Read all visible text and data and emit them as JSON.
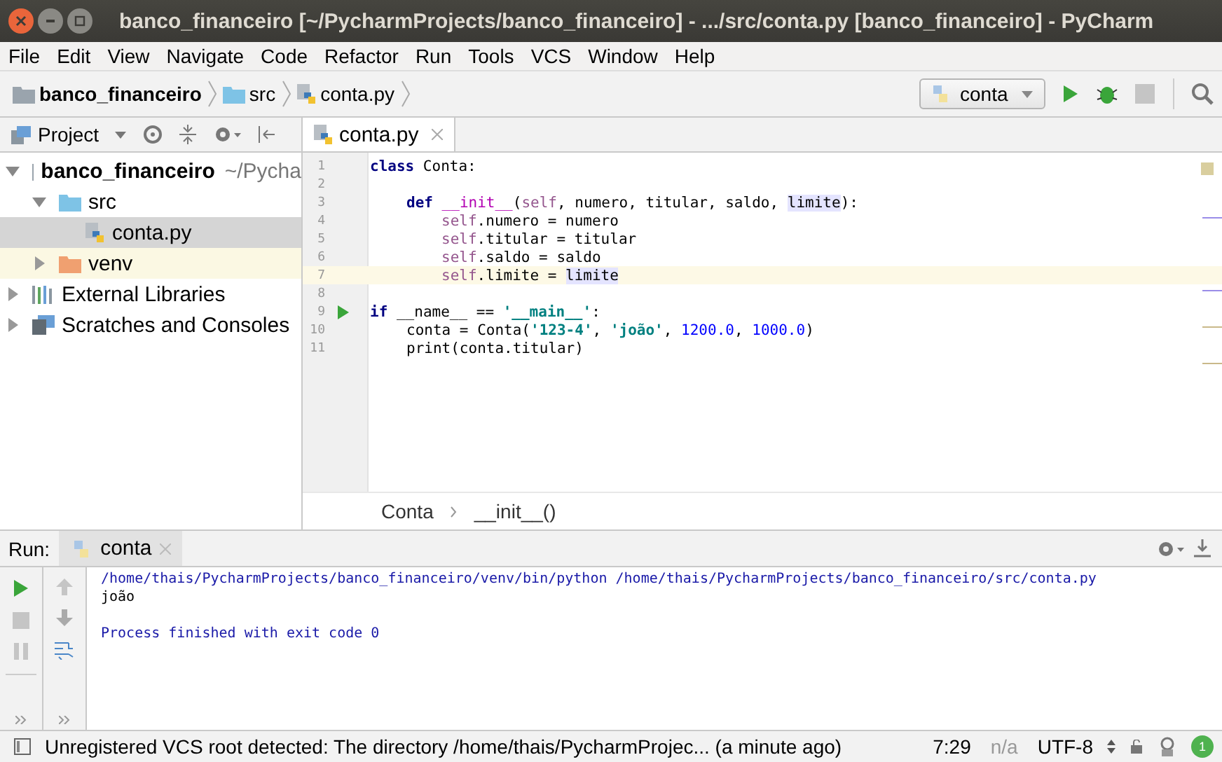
{
  "window": {
    "title": "banco_financeiro [~/PycharmProjects/banco_financeiro] - .../src/conta.py [banco_financeiro] - PyCharm"
  },
  "menu": [
    "File",
    "Edit",
    "View",
    "Navigate",
    "Code",
    "Refactor",
    "Run",
    "Tools",
    "VCS",
    "Window",
    "Help"
  ],
  "breadcrumbs": [
    {
      "kind": "project",
      "label": "banco_financeiro"
    },
    {
      "kind": "source",
      "label": "src"
    },
    {
      "kind": "file",
      "label": "conta.py"
    }
  ],
  "run_config": {
    "label": "conta"
  },
  "project_panel": {
    "title": "Project",
    "tree": [
      {
        "kind": "project",
        "label": "banco_financeiro",
        "path": "~/Pycha",
        "expanded": true,
        "selected": false,
        "children": [
          {
            "kind": "source",
            "label": "src",
            "expanded": true,
            "selected": false,
            "children": [
              {
                "kind": "file",
                "label": "conta.py",
                "selected": true
              }
            ]
          },
          {
            "kind": "excluded",
            "label": "venv",
            "expanded": false,
            "selected": false
          }
        ]
      },
      {
        "kind": "libraries",
        "label": "External Libraries",
        "expanded": false,
        "selected": false
      },
      {
        "kind": "scratches",
        "label": "Scratches and Consoles",
        "expanded": false,
        "selected": false
      }
    ]
  },
  "editor": {
    "tabs": [
      {
        "label": "conta.py",
        "selected": true
      }
    ],
    "lines": [
      {
        "number": "1",
        "current": false,
        "run_marker": false,
        "kind": "top",
        "tokens": [
          {
            "kind": "kw",
            "text": "class"
          },
          {
            "kind": "plain",
            "text": " Conta:"
          }
        ]
      },
      {
        "number": "2",
        "current": false,
        "run_marker": false
      },
      {
        "number": "3",
        "current": false,
        "run_marker": false,
        "kind": "block",
        "tokens": [
          {
            "kind": "kw",
            "text": "def "
          },
          {
            "kind": "magic",
            "text": "__init__"
          },
          {
            "kind": "plain",
            "text": "("
          },
          {
            "kind": "self",
            "text": "self"
          },
          {
            "kind": "plain",
            "text": ", numero, titular, saldo, "
          },
          {
            "kind": "hl",
            "text": "limite"
          },
          {
            "kind": "plain",
            "text": "):"
          }
        ]
      },
      {
        "number": "4",
        "current": false,
        "run_marker": false,
        "kind": "inner",
        "tokens": [
          {
            "kind": "self",
            "text": "self"
          },
          {
            "kind": "plain",
            "text": ".numero = numero"
          }
        ]
      },
      {
        "number": "5",
        "current": false,
        "run_marker": false,
        "kind": "inner",
        "tokens": [
          {
            "kind": "self",
            "text": "self"
          },
          {
            "kind": "plain",
            "text": ".titular = titular"
          }
        ]
      },
      {
        "number": "6",
        "current": false,
        "run_marker": false,
        "kind": "inner",
        "tokens": [
          {
            "kind": "self",
            "text": "self"
          },
          {
            "kind": "plain",
            "text": ".saldo = saldo"
          }
        ]
      },
      {
        "number": "7",
        "current": true,
        "run_marker": false,
        "kind": "inner",
        "tokens": [
          {
            "kind": "self",
            "text": "self"
          },
          {
            "kind": "plain",
            "text": ".limite = "
          },
          {
            "kind": "hl",
            "text": "limite"
          }
        ]
      },
      {
        "number": "8",
        "current": false,
        "run_marker": false
      },
      {
        "number": "9",
        "current": false,
        "run_marker": true,
        "kind": "top",
        "tokens": [
          {
            "kind": "kw",
            "text": "if"
          },
          {
            "kind": "plain",
            "text": " __name__ == "
          },
          {
            "kind": "str",
            "text": "'__main__'"
          },
          {
            "kind": "plain",
            "text": ":"
          }
        ]
      },
      {
        "number": "10",
        "current": false,
        "run_marker": false,
        "kind": "block",
        "tokens": [
          {
            "kind": "plain",
            "text": "conta = Conta("
          },
          {
            "kind": "str",
            "text": "'123-4'"
          },
          {
            "kind": "plain",
            "text": ", "
          },
          {
            "kind": "str",
            "text": "'joão'"
          },
          {
            "kind": "plain",
            "text": ", "
          },
          {
            "kind": "num",
            "text": "1200.0"
          },
          {
            "kind": "plain",
            "text": ", "
          },
          {
            "kind": "num",
            "text": "1000.0"
          },
          {
            "kind": "plain",
            "text": ")"
          }
        ]
      },
      {
        "number": "11",
        "current": false,
        "run_marker": false,
        "kind": "block",
        "tokens": [
          {
            "kind": "plain",
            "text": "print(conta.titular)"
          }
        ]
      }
    ],
    "structure": [
      "Conta",
      "__init__()"
    ]
  },
  "run_panel": {
    "title": "Run:",
    "tab": "conta",
    "console": [
      {
        "kind": "command",
        "text": "/home/thais/PycharmProjects/banco_financeiro/venv/bin/python /home/thais/PycharmProjects/banco_financeiro/src/conta.py"
      },
      {
        "kind": "output",
        "text": "joão"
      },
      {
        "kind": "system",
        "text": "Process finished with exit code 0"
      }
    ]
  },
  "status_bar": {
    "message": "Unregistered VCS root detected: The directory /home/thais/PycharmProjec... (a minute ago)",
    "position": "7:29",
    "line_separator": "n/a",
    "encoding": "UTF-8",
    "notifications": "1"
  }
}
